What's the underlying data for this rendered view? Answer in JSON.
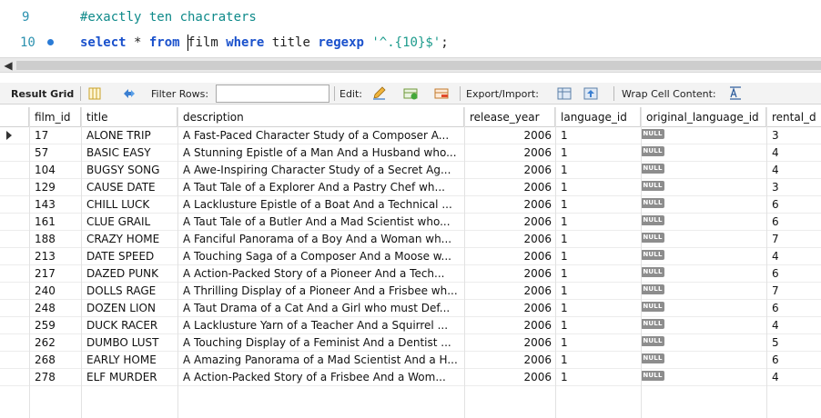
{
  "editor": {
    "lines": [
      {
        "number": "9",
        "text": "#exactly ten chacraters"
      },
      {
        "number": "10",
        "kw1": "select",
        "t1": " * ",
        "kw2": "from",
        "t2": " ",
        "t3": "film",
        "t4": " ",
        "kw3": "where",
        "t5": " title ",
        "kw4": "regexp",
        "t6": " ",
        "str": "'^.{10}$'",
        "t7": ";"
      }
    ]
  },
  "toolbar": {
    "result_grid": "Result Grid",
    "filter_rows": "Filter Rows:",
    "filter_value": "",
    "edit": "Edit:",
    "export_import": "Export/Import:",
    "wrap_cell": "Wrap Cell Content:"
  },
  "grid": {
    "columns": [
      "film_id",
      "title",
      "description",
      "release_year",
      "language_id",
      "original_language_id",
      "rental_d"
    ],
    "null_label": "NULL",
    "rows": [
      {
        "film_id": "17",
        "title": "ALONE TRIP",
        "description": "A Fast-Paced Character Study of a Composer A...",
        "release_year": "2006",
        "language_id": "1",
        "rental": "3"
      },
      {
        "film_id": "57",
        "title": "BASIC EASY",
        "description": "A Stunning Epistle of a Man And a Husband who...",
        "release_year": "2006",
        "language_id": "1",
        "rental": "4"
      },
      {
        "film_id": "104",
        "title": "BUGSY SONG",
        "description": "A Awe-Inspiring Character Study of a Secret Ag...",
        "release_year": "2006",
        "language_id": "1",
        "rental": "4"
      },
      {
        "film_id": "129",
        "title": "CAUSE DATE",
        "description": "A Taut Tale of a Explorer And a Pastry Chef wh...",
        "release_year": "2006",
        "language_id": "1",
        "rental": "3"
      },
      {
        "film_id": "143",
        "title": "CHILL LUCK",
        "description": "A Lacklusture Epistle of a Boat And a Technical ...",
        "release_year": "2006",
        "language_id": "1",
        "rental": "6"
      },
      {
        "film_id": "161",
        "title": "CLUE GRAIL",
        "description": "A Taut Tale of a Butler And a Mad Scientist who...",
        "release_year": "2006",
        "language_id": "1",
        "rental": "6"
      },
      {
        "film_id": "188",
        "title": "CRAZY HOME",
        "description": "A Fanciful Panorama of a Boy And a Woman wh...",
        "release_year": "2006",
        "language_id": "1",
        "rental": "7"
      },
      {
        "film_id": "213",
        "title": "DATE SPEED",
        "description": "A Touching Saga of a Composer And a Moose w...",
        "release_year": "2006",
        "language_id": "1",
        "rental": "4"
      },
      {
        "film_id": "217",
        "title": "DAZED PUNK",
        "description": "A Action-Packed Story of a Pioneer And a Tech...",
        "release_year": "2006",
        "language_id": "1",
        "rental": "6"
      },
      {
        "film_id": "240",
        "title": "DOLLS RAGE",
        "description": "A Thrilling Display of a Pioneer And a Frisbee wh...",
        "release_year": "2006",
        "language_id": "1",
        "rental": "7"
      },
      {
        "film_id": "248",
        "title": "DOZEN LION",
        "description": "A Taut Drama of a Cat And a Girl who must Def...",
        "release_year": "2006",
        "language_id": "1",
        "rental": "6"
      },
      {
        "film_id": "259",
        "title": "DUCK RACER",
        "description": "A Lacklusture Yarn of a Teacher And a Squirrel ...",
        "release_year": "2006",
        "language_id": "1",
        "rental": "4"
      },
      {
        "film_id": "262",
        "title": "DUMBO LUST",
        "description": "A Touching Display of a Feminist And a Dentist ...",
        "release_year": "2006",
        "language_id": "1",
        "rental": "5"
      },
      {
        "film_id": "268",
        "title": "EARLY HOME",
        "description": "A Amazing Panorama of a Mad Scientist And a H...",
        "release_year": "2006",
        "language_id": "1",
        "rental": "6"
      },
      {
        "film_id": "278",
        "title": "ELF MURDER",
        "description": "A Action-Packed Story of a Frisbee And a Wom...",
        "release_year": "2006",
        "language_id": "1",
        "rental": "4"
      }
    ]
  },
  "colors": {
    "keyword": "#1a51cc",
    "comment": "#0f8a8a",
    "string": "#1c9b8c",
    "line_number": "#2b91af"
  }
}
